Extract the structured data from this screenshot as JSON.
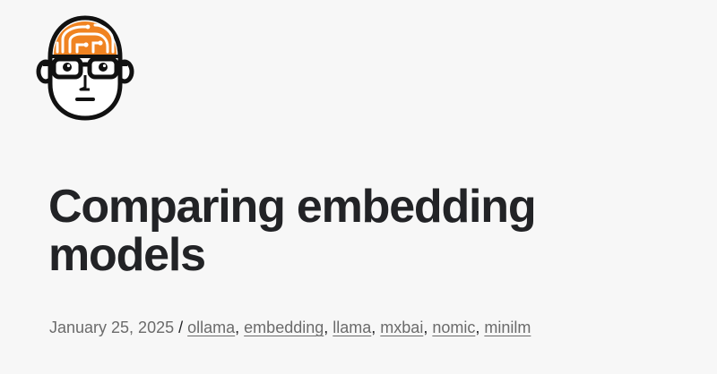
{
  "header": {
    "logo_icon": "nerd-face-circuit-brain-icon",
    "accent_color": "#f08321"
  },
  "post": {
    "title": "Comparing embedding models",
    "date": "January 25, 2025",
    "date_separator": " / ",
    "tag_separator": ", ",
    "tags": [
      "ollama",
      "embedding",
      "llama",
      "mxbai",
      "nomic",
      "minilm"
    ]
  }
}
